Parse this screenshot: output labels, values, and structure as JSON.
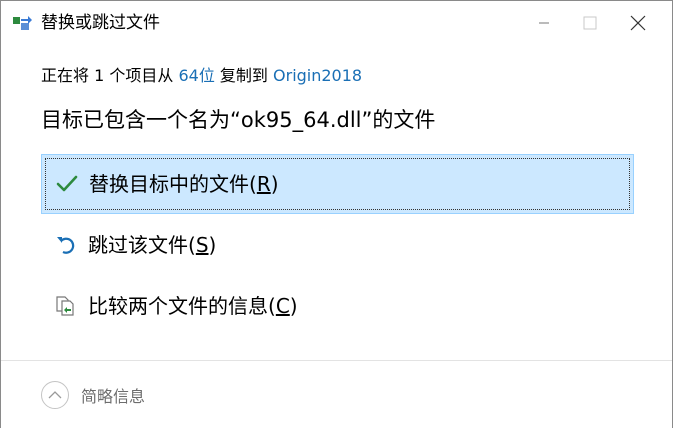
{
  "window": {
    "title": "替换或跳过文件"
  },
  "status": {
    "prefix": "正在将 1 个项目从 ",
    "source": "64位",
    "middle": " 复制到 ",
    "destination": "Origin2018"
  },
  "headline": "目标已包含一个名为“ok95_64.dll”的文件",
  "options": [
    {
      "label": "替换目标中的文件(",
      "key": "R",
      "suffix": ")",
      "icon": "checkmark-icon"
    },
    {
      "label": "跳过该文件(",
      "key": "S",
      "suffix": ")",
      "icon": "undo-arrow-icon"
    },
    {
      "label": "比较两个文件的信息(",
      "key": "C",
      "suffix": ")",
      "icon": "compare-files-icon"
    }
  ],
  "footer": {
    "details_label": "简略信息",
    "icon": "chevron-up-icon"
  },
  "colors": {
    "link": "#1a6fb5",
    "selected_bg": "#cce8ff",
    "selected_border": "#99d1ff",
    "check_green": "#2d8a3e"
  }
}
